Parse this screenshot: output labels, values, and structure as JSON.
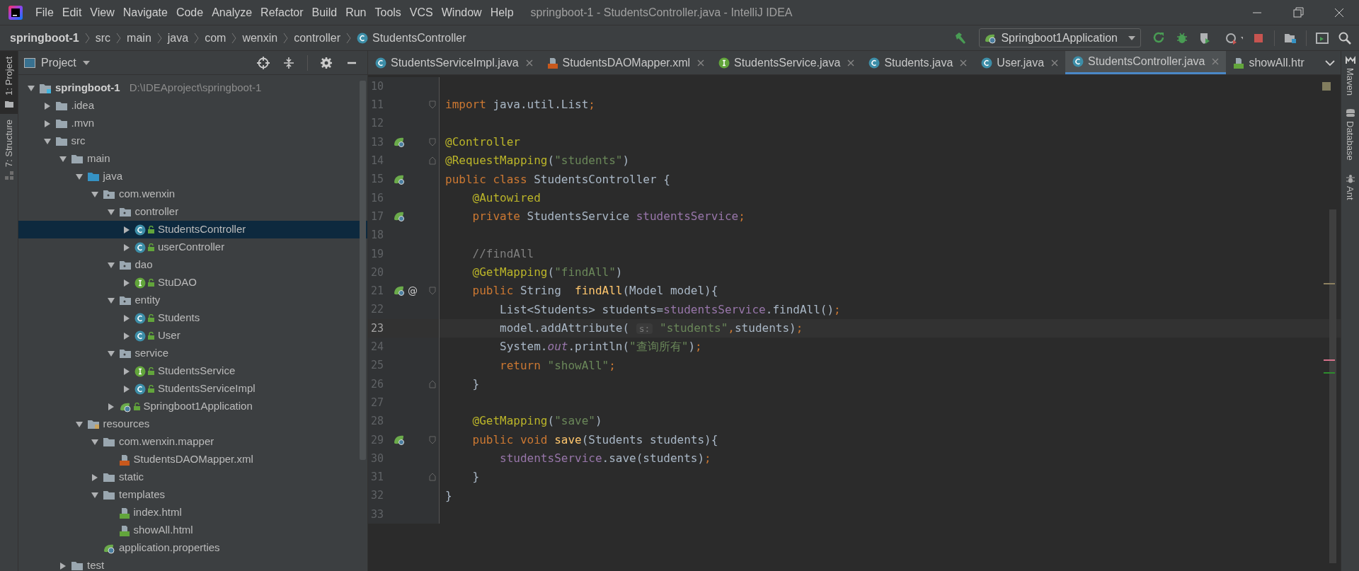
{
  "window": {
    "title": "springboot-1 - StudentsController.java - IntelliJ IDEA"
  },
  "menu": [
    "File",
    "Edit",
    "View",
    "Navigate",
    "Code",
    "Analyze",
    "Refactor",
    "Build",
    "Run",
    "Tools",
    "VCS",
    "Window",
    "Help"
  ],
  "breadcrumbs": [
    {
      "label": "springboot-1",
      "kind": "project"
    },
    {
      "label": "src",
      "kind": "folder"
    },
    {
      "label": "main",
      "kind": "folder"
    },
    {
      "label": "java",
      "kind": "folder"
    },
    {
      "label": "com",
      "kind": "folder"
    },
    {
      "label": "wenxin",
      "kind": "folder"
    },
    {
      "label": "controller",
      "kind": "folder"
    },
    {
      "label": "StudentsController",
      "kind": "class"
    }
  ],
  "run_config": "Springboot1Application",
  "left_strip": [
    {
      "label": "1: Project",
      "selected": true
    },
    {
      "label": "7: Structure",
      "selected": false
    }
  ],
  "right_strip": [
    "Maven",
    "Database",
    "Ant"
  ],
  "project_panel": {
    "title": "Project"
  },
  "tree": [
    {
      "label": "springboot-1",
      "path": "D:\\IDEAproject\\springboot-1",
      "kind": "module",
      "expanded": true,
      "selected": false,
      "children": [
        {
          "label": ".idea",
          "kind": "folder",
          "expanded": false,
          "selected": false
        },
        {
          "label": ".mvn",
          "kind": "folder",
          "expanded": false,
          "selected": false
        },
        {
          "label": "src",
          "kind": "folder",
          "expanded": true,
          "selected": false,
          "children": [
            {
              "label": "main",
              "kind": "folder",
              "expanded": true,
              "selected": false,
              "children": [
                {
                  "label": "java",
                  "kind": "source",
                  "expanded": true,
                  "selected": false,
                  "children": [
                    {
                      "label": "com.wenxin",
                      "kind": "package",
                      "expanded": true,
                      "selected": false,
                      "children": [
                        {
                          "label": "controller",
                          "kind": "package",
                          "expanded": true,
                          "selected": false,
                          "children": [
                            {
                              "label": "StudentsController",
                              "kind": "class",
                              "expanded": false,
                              "selected": true
                            },
                            {
                              "label": "userController",
                              "kind": "class",
                              "expanded": false,
                              "selected": false
                            }
                          ]
                        },
                        {
                          "label": "dao",
                          "kind": "package",
                          "expanded": true,
                          "selected": false,
                          "children": [
                            {
                              "label": "StuDAO",
                              "kind": "interface",
                              "expanded": false,
                              "selected": false
                            }
                          ]
                        },
                        {
                          "label": "entity",
                          "kind": "package",
                          "expanded": true,
                          "selected": false,
                          "children": [
                            {
                              "label": "Students",
                              "kind": "class",
                              "expanded": false,
                              "selected": false
                            },
                            {
                              "label": "User",
                              "kind": "class",
                              "expanded": false,
                              "selected": false
                            }
                          ]
                        },
                        {
                          "label": "service",
                          "kind": "package",
                          "expanded": true,
                          "selected": false,
                          "children": [
                            {
                              "label": "StudentsService",
                              "kind": "interface",
                              "expanded": false,
                              "selected": false
                            },
                            {
                              "label": "StudentsServiceImpl",
                              "kind": "class",
                              "expanded": false,
                              "selected": false
                            }
                          ]
                        },
                        {
                          "label": "Springboot1Application",
                          "kind": "app",
                          "expanded": false,
                          "selected": false
                        }
                      ]
                    }
                  ]
                },
                {
                  "label": "resources",
                  "kind": "resources",
                  "expanded": true,
                  "selected": false,
                  "children": [
                    {
                      "label": "com.wenxin.mapper",
                      "kind": "folder",
                      "expanded": true,
                      "selected": false,
                      "children": [
                        {
                          "label": "StudentsDAOMapper.xml",
                          "kind": "xml",
                          "selected": false
                        }
                      ]
                    },
                    {
                      "label": "static",
                      "kind": "folder",
                      "expanded": false,
                      "selected": false
                    },
                    {
                      "label": "templates",
                      "kind": "folder",
                      "expanded": true,
                      "selected": false,
                      "children": [
                        {
                          "label": "index.html",
                          "kind": "html",
                          "selected": false
                        },
                        {
                          "label": "showAll.html",
                          "kind": "html",
                          "selected": false
                        }
                      ]
                    },
                    {
                      "label": "application.properties",
                      "kind": "properties",
                      "selected": false
                    }
                  ]
                }
              ]
            },
            {
              "label": "test",
              "kind": "folder",
              "expanded": false,
              "selected": false
            }
          ]
        }
      ]
    }
  ],
  "tabs": [
    {
      "label": "StudentsServiceImpl.java",
      "kind": "class",
      "selected": false,
      "closable": true
    },
    {
      "label": "StudentsDAOMapper.xml",
      "kind": "xml",
      "selected": false,
      "closable": true
    },
    {
      "label": "StudentsService.java",
      "kind": "interface",
      "selected": false,
      "closable": true
    },
    {
      "label": "Students.java",
      "kind": "class",
      "selected": false,
      "closable": true
    },
    {
      "label": "User.java",
      "kind": "class",
      "selected": false,
      "closable": true
    },
    {
      "label": "StudentsController.java",
      "kind": "class",
      "selected": true,
      "closable": true
    },
    {
      "label": "showAll.htr",
      "kind": "html",
      "selected": false,
      "closable": false
    }
  ],
  "code": [
    {
      "n": "10",
      "current": false
    },
    {
      "n": "11",
      "current": false,
      "fold_start": true,
      "tokens": [
        {
          "text": "import ",
          "kind": "kw"
        },
        {
          "text": "java.util.List",
          "kind": "plain"
        },
        {
          "text": ";",
          "kind": "kw"
        }
      ]
    },
    {
      "n": "12",
      "current": false
    },
    {
      "n": "13",
      "current": false,
      "fold_start": true,
      "bean": true,
      "tokens": [
        {
          "text": "@Controller",
          "kind": "ann"
        }
      ]
    },
    {
      "n": "14",
      "current": false,
      "fold_end": true,
      "tokens": [
        {
          "text": "@RequestMapping",
          "kind": "ann"
        },
        {
          "text": "(",
          "kind": "plain"
        },
        {
          "text": "\"students\"",
          "kind": "str"
        },
        {
          "text": ")",
          "kind": "plain"
        }
      ]
    },
    {
      "n": "15",
      "current": false,
      "bean": true,
      "tokens": [
        {
          "text": "public class ",
          "kind": "kw"
        },
        {
          "text": "StudentsController {",
          "kind": "plain"
        }
      ]
    },
    {
      "n": "16",
      "current": false,
      "tokens": [
        {
          "text": "    @Autowired",
          "kind": "ann"
        }
      ]
    },
    {
      "n": "17",
      "current": false,
      "bean": true,
      "tokens": [
        {
          "text": "    private ",
          "kind": "kw"
        },
        {
          "text": "StudentsService ",
          "kind": "plain"
        },
        {
          "text": "studentsService",
          "kind": "field"
        },
        {
          "text": ";",
          "kind": "kw"
        }
      ]
    },
    {
      "n": "18",
      "current": false
    },
    {
      "n": "19",
      "current": false,
      "tokens": [
        {
          "text": "    //findAll",
          "kind": "comment"
        }
      ]
    },
    {
      "n": "20",
      "current": false,
      "tokens": [
        {
          "text": "    @GetMapping",
          "kind": "ann"
        },
        {
          "text": "(",
          "kind": "plain"
        },
        {
          "text": "\"findAll\"",
          "kind": "str"
        },
        {
          "text": ")",
          "kind": "plain"
        }
      ]
    },
    {
      "n": "21",
      "current": false,
      "fold_start": true,
      "bean": true,
      "gutter_mark": "@",
      "tokens": [
        {
          "text": "    public ",
          "kind": "kw"
        },
        {
          "text": "String  ",
          "kind": "plain"
        },
        {
          "text": "findAll",
          "kind": "method"
        },
        {
          "text": "(Model model){",
          "kind": "plain"
        }
      ]
    },
    {
      "n": "22",
      "current": false,
      "tokens": [
        {
          "text": "        List<Students> students=",
          "kind": "plain"
        },
        {
          "text": "studentsService",
          "kind": "field"
        },
        {
          "text": ".findAll()",
          "kind": "plain"
        },
        {
          "text": ";",
          "kind": "kw"
        }
      ]
    },
    {
      "n": "23",
      "current": true,
      "tokens": [
        {
          "text": "        model.addAttribute( ",
          "kind": "plain"
        },
        {
          "text": "s:",
          "kind": "hint"
        },
        {
          "text": " \"students\"",
          "kind": "str"
        },
        {
          "text": ",",
          "kind": "kw"
        },
        {
          "text": "students)",
          "kind": "plain"
        },
        {
          "text": ";",
          "kind": "kw"
        }
      ]
    },
    {
      "n": "24",
      "current": false,
      "tokens": [
        {
          "text": "        System.",
          "kind": "plain"
        },
        {
          "text": "out",
          "kind": "static"
        },
        {
          "text": ".println(",
          "kind": "plain"
        },
        {
          "text": "\"查询所有\"",
          "kind": "str"
        },
        {
          "text": ")",
          "kind": "plain"
        },
        {
          "text": ";",
          "kind": "kw"
        }
      ]
    },
    {
      "n": "25",
      "current": false,
      "tokens": [
        {
          "text": "        return ",
          "kind": "kw"
        },
        {
          "text": "\"showAll\"",
          "kind": "str"
        },
        {
          "text": ";",
          "kind": "kw"
        }
      ]
    },
    {
      "n": "26",
      "current": false,
      "fold_end": true,
      "tokens": [
        {
          "text": "    }",
          "kind": "plain"
        }
      ]
    },
    {
      "n": "27",
      "current": false
    },
    {
      "n": "28",
      "current": false,
      "tokens": [
        {
          "text": "    @GetMapping",
          "kind": "ann"
        },
        {
          "text": "(",
          "kind": "plain"
        },
        {
          "text": "\"save\"",
          "kind": "str"
        },
        {
          "text": ")",
          "kind": "plain"
        }
      ]
    },
    {
      "n": "29",
      "current": false,
      "fold_start": true,
      "bean": true,
      "tokens": [
        {
          "text": "    public void ",
          "kind": "kw"
        },
        {
          "text": "save",
          "kind": "method"
        },
        {
          "text": "(Students students){",
          "kind": "plain"
        }
      ]
    },
    {
      "n": "30",
      "current": false,
      "tokens": [
        {
          "text": "        studentsService",
          "kind": "field"
        },
        {
          "text": ".save(students)",
          "kind": "plain"
        },
        {
          "text": ";",
          "kind": "kw"
        }
      ]
    },
    {
      "n": "31",
      "current": false,
      "fold_end": true,
      "tokens": [
        {
          "text": "    }",
          "kind": "plain"
        }
      ]
    },
    {
      "n": "32",
      "current": false,
      "tokens": [
        {
          "text": "}",
          "kind": "plain"
        }
      ]
    },
    {
      "n": "33",
      "current": false
    }
  ]
}
